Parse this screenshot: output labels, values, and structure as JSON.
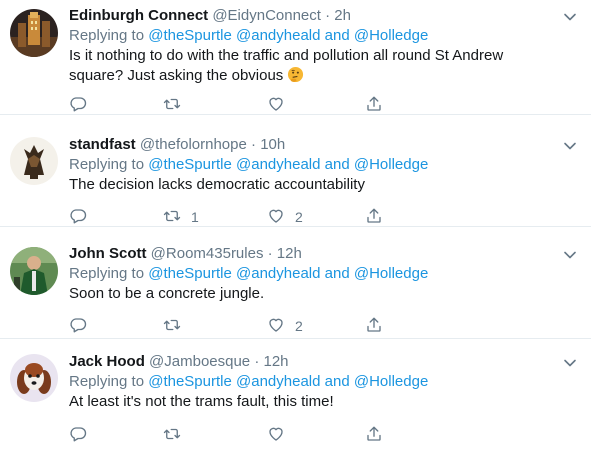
{
  "tweets": [
    {
      "name": "Edinburgh Connect",
      "handle": "@EidynConnect",
      "dot": "·",
      "time": "2h",
      "replying_prefix": "Replying to",
      "mention1": "@theSpurtle",
      "mention2": "@andyheald",
      "and": "and",
      "mention3": "@Holledge",
      "text": "Is it nothing to do with the traffic and pollution all round St Andrew square? Just asking the obvious",
      "retweets": "",
      "likes": ""
    },
    {
      "name": "standfast",
      "handle": "@thefolornhope",
      "dot": "·",
      "time": "10h",
      "replying_prefix": "Replying to",
      "mention1": "@theSpurtle",
      "mention2": "@andyheald",
      "and": "and",
      "mention3": "@Holledge",
      "text": "The decision lacks democratic accountability",
      "retweets": "1",
      "likes": "2"
    },
    {
      "name": "John Scott",
      "handle": "@Room435rules",
      "dot": "·",
      "time": "12h",
      "replying_prefix": "Replying to",
      "mention1": "@theSpurtle",
      "mention2": "@andyheald",
      "and": "and",
      "mention3": "@Holledge",
      "text": "Soon to be a concrete jungle.",
      "retweets": "",
      "likes": "2"
    },
    {
      "name": "Jack Hood",
      "handle": "@Jamboesque",
      "dot": "·",
      "time": "12h",
      "replying_prefix": "Replying to",
      "mention1": "@theSpurtle",
      "mention2": "@andyheald",
      "and": "and",
      "mention3": "@Holledge",
      "text": "At least it's not the trams fault, this time!",
      "retweets": "",
      "likes": ""
    }
  ],
  "icons": {
    "reply": "reply-icon",
    "retweet": "retweet-icon",
    "like": "heart-icon",
    "share": "share-icon",
    "more": "chevron-down-icon",
    "emoji": "thinking-face-emoji"
  },
  "colors": {
    "link": "#1b95e0",
    "secondary": "#657786",
    "text": "#14171a",
    "divider": "#e6ecf0"
  }
}
